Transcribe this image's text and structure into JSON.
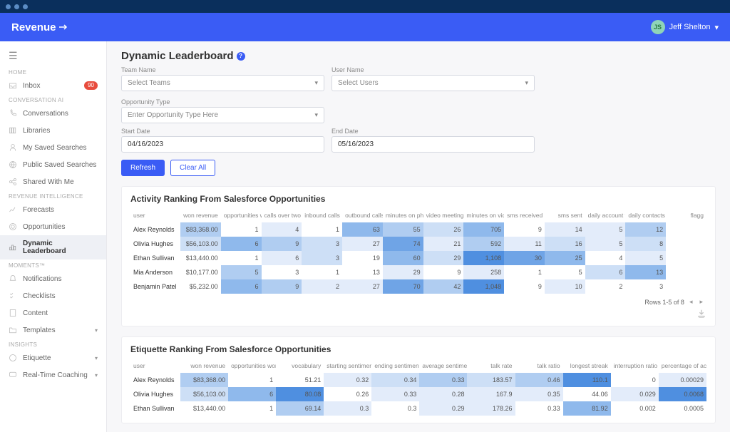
{
  "app": {
    "brand": "Revenue"
  },
  "user": {
    "initials": "JS",
    "name": "Jeff Shelton"
  },
  "sidebar": {
    "home_label": "HOME",
    "conv_label": "CONVERSATION AI",
    "intel_label": "REVENUE INTELLIGENCE",
    "moments_label": "MOMENTS™",
    "insights_label": "INSIGHTS",
    "inbox": "Inbox",
    "inbox_badge": "90",
    "conversations": "Conversations",
    "libraries": "Libraries",
    "my_saved": "My Saved Searches",
    "public_saved": "Public Saved Searches",
    "shared": "Shared With Me",
    "forecasts": "Forecasts",
    "opportunities": "Opportunities",
    "dynamic_lb": "Dynamic Leaderboard",
    "notifications": "Notifications",
    "checklists": "Checklists",
    "content": "Content",
    "templates": "Templates",
    "etiquette": "Etiquette",
    "realtime": "Real-Time Coaching"
  },
  "page": {
    "title": "Dynamic Leaderboard",
    "team_label": "Team Name",
    "team_ph": "Select Teams",
    "user_label": "User Name",
    "user_ph": "Select Users",
    "opp_label": "Opportunity Type",
    "opp_ph": "Enter Opportunity Type Here",
    "start_label": "Start Date",
    "start_val": "04/16/2023",
    "end_label": "End Date",
    "end_val": "05/16/2023",
    "refresh": "Refresh",
    "clear": "Clear All"
  },
  "activity": {
    "title": "Activity Ranking From Salesforce Opportunities",
    "headers": [
      "user",
      "won revenue",
      "opportunities won",
      "calls over two minutes",
      "inbound calls",
      "outbound calls",
      "minutes on phone",
      "video meetings",
      "minutes on video",
      "sms received",
      "sms sent",
      "daily account touched",
      "daily contacts touched",
      "flagg"
    ],
    "rows": [
      {
        "name": "Alex Reynolds",
        "cells": [
          "$83,368.00",
          "1",
          "4",
          "1",
          "63",
          "55",
          "26",
          "705",
          "9",
          "14",
          "5",
          "12",
          ""
        ]
      },
      {
        "name": "Olivia Hughes",
        "cells": [
          "$56,103.00",
          "6",
          "9",
          "3",
          "27",
          "74",
          "21",
          "592",
          "11",
          "16",
          "5",
          "8",
          ""
        ]
      },
      {
        "name": "Ethan Sullivan",
        "cells": [
          "$13,440.00",
          "1",
          "6",
          "3",
          "19",
          "60",
          "29",
          "1,108",
          "30",
          "25",
          "4",
          "5",
          ""
        ]
      },
      {
        "name": "Mia Anderson",
        "cells": [
          "$10,177.00",
          "5",
          "3",
          "1",
          "13",
          "29",
          "9",
          "258",
          "1",
          "5",
          "6",
          "13",
          ""
        ]
      },
      {
        "name": "Benjamin Patel",
        "cells": [
          "$5,232.00",
          "6",
          "9",
          "2",
          "27",
          "70",
          "42",
          "1,048",
          "9",
          "10",
          "2",
          "3",
          ""
        ]
      }
    ],
    "heat": [
      [
        "h3",
        "",
        "h1",
        "",
        "h4",
        "h3",
        "h2",
        "h4",
        "",
        "h1",
        "h1",
        "h3",
        ""
      ],
      [
        "h2",
        "h4",
        "h3",
        "h2",
        "h1",
        "h5",
        "h1",
        "h3",
        "h1",
        "h2",
        "h1",
        "h2",
        ""
      ],
      [
        "",
        "",
        "h1",
        "h2",
        "",
        "h4",
        "h2",
        "h6",
        "h5",
        "h4",
        "",
        "h1",
        ""
      ],
      [
        "",
        "h3",
        "",
        "",
        "",
        "h1",
        "",
        "h1",
        "",
        "",
        "h2",
        "h4",
        ""
      ],
      [
        "",
        "h4",
        "h3",
        "h1",
        "h1",
        "h5",
        "h3",
        "h6",
        "",
        "h1",
        "",
        "",
        ""
      ]
    ],
    "pager": "Rows 1-5 of 8"
  },
  "etiquette": {
    "title": "Etiquette Ranking From Salesforce Opportunities",
    "headers": [
      "user",
      "won revenue",
      "opportunities won",
      "vocabulary",
      "starting sentiment",
      "ending sentiment",
      "average sentiment",
      "talk rate",
      "talk ratio",
      "longest streak",
      "interruption ratio",
      "percentage of active listening"
    ],
    "rows": [
      {
        "name": "Alex Reynolds",
        "cells": [
          "$83,368.00",
          "1",
          "51.21",
          "0.32",
          "0.34",
          "0.33",
          "183.57",
          "0.46",
          "110.1",
          "0",
          "0.00029"
        ]
      },
      {
        "name": "Olivia Hughes",
        "cells": [
          "$56,103.00",
          "6",
          "80.08",
          "0.26",
          "0.33",
          "0.28",
          "167.9",
          "0.35",
          "44.06",
          "0.029",
          "0.0068"
        ]
      },
      {
        "name": "Ethan Sullivan",
        "cells": [
          "$13,440.00",
          "1",
          "69.14",
          "0.3",
          "0.3",
          "0.29",
          "178.26",
          "0.33",
          "81.92",
          "0.002",
          "0.0005"
        ]
      }
    ],
    "heat": [
      [
        "h3",
        "",
        "",
        "h1",
        "h2",
        "h3",
        "h2",
        "h3",
        "h6",
        "",
        "h1"
      ],
      [
        "h2",
        "h4",
        "h6",
        "",
        "h1",
        "h1",
        "h1",
        "h1",
        "",
        "h1",
        "h6"
      ],
      [
        "",
        "",
        "h3",
        "h1",
        "",
        "h1",
        "h1",
        "",
        "h4",
        "",
        ""
      ]
    ]
  }
}
